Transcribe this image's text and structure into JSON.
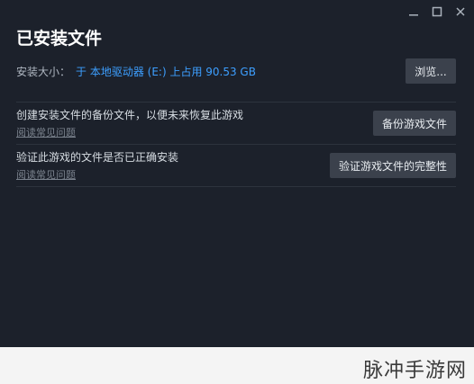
{
  "window": {
    "title": "已安装文件"
  },
  "install_size": {
    "label": "安装大小：",
    "value": "于 本地驱动器 (E:) 上占用 90.53 GB",
    "browse_label": "浏览..."
  },
  "backup": {
    "description": "创建安装文件的备份文件，以便未来恢复此游戏",
    "faq_label": "阅读常见问题",
    "button_label": "备份游戏文件"
  },
  "verify": {
    "description": "验证此游戏的文件是否已正确安装",
    "faq_label": "阅读常见问题",
    "button_label": "验证游戏文件的完整性"
  },
  "watermark": "脉冲手游网",
  "colors": {
    "background": "#1c212b",
    "accent": "#3d9fff",
    "button": "#3b414c"
  }
}
